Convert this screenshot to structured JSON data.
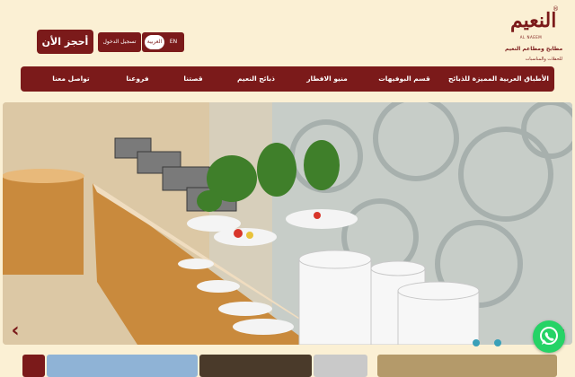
{
  "header": {
    "logo": {
      "mark_text": "النعيم",
      "registered": "®",
      "sub_text": "AL NAEEM",
      "line1": "مطابخ ومطاعم النعيم",
      "line2": "للحفلات والمناسبات"
    },
    "book_button": "أحجز الأن",
    "login_button": "تسجيل الدخول",
    "language": {
      "active": "العربية",
      "other": "EN"
    }
  },
  "nav": {
    "items": [
      "الأطباق العربية المميزة للذبائح",
      "قسم البوفيهات",
      "منيو الافطار",
      "ذبائح النعيم",
      "قصتنا",
      "فروعنا",
      "تواصل معنا"
    ]
  },
  "hero": {
    "prev_arrow": "‹",
    "next_arrow": "›",
    "slides_total": 2,
    "active_slide": 1
  },
  "icons": {
    "whatsapp": "whatsapp-icon",
    "prev": "chevron-left-icon",
    "next": "chevron-right-icon"
  },
  "colors": {
    "brand": "#7b1a1a",
    "background": "#fbf0d4",
    "whatsapp": "#25d366"
  }
}
